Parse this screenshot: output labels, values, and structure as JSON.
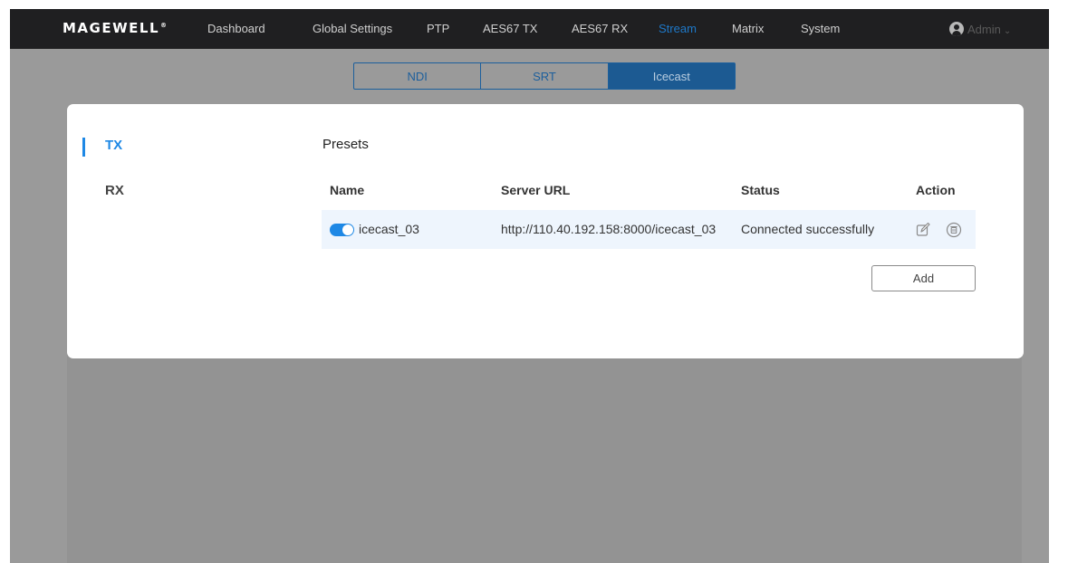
{
  "header": {
    "logo": "MAGEWELL",
    "logo_mark": "®",
    "nav": [
      {
        "label": "Dashboard",
        "active": false
      },
      {
        "label": "Global Settings",
        "active": false
      },
      {
        "label": "PTP",
        "active": false
      },
      {
        "label": "AES67 TX",
        "active": false
      },
      {
        "label": "AES67 RX",
        "active": false
      },
      {
        "label": "Stream",
        "active": true
      },
      {
        "label": "Matrix",
        "active": false
      },
      {
        "label": "System",
        "active": false
      }
    ],
    "user": {
      "name": "Admin",
      "icon": "user-avatar-icon",
      "chevron": "chevron-down-icon"
    }
  },
  "stream_tabs": [
    {
      "label": "NDI",
      "active": false
    },
    {
      "label": "SRT",
      "active": false
    },
    {
      "label": "Icecast",
      "active": true
    }
  ],
  "sidebar": {
    "items": [
      {
        "label": "TX",
        "active": true
      },
      {
        "label": "RX",
        "active": false
      }
    ]
  },
  "presets": {
    "title": "Presets",
    "columns": [
      "Name",
      "Server URL",
      "Status",
      "Action"
    ],
    "rows": [
      {
        "enabled": true,
        "name": "icecast_03",
        "server_url": "http://110.40.192.158:8000/icecast_03",
        "status": "Connected successfully",
        "actions": [
          "edit-icon",
          "delete-icon"
        ]
      }
    ],
    "add_label": "Add"
  },
  "colors": {
    "accent": "#1e88e5",
    "active_nav": "#1e78c8",
    "topbar": "#1f1f21",
    "overlay": "#9a9a9a",
    "row_highlight": "#eef5fd"
  }
}
